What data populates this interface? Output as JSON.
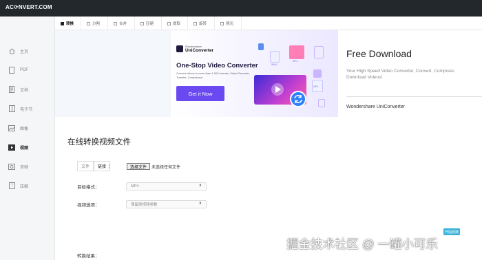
{
  "brand": "AC⟳NVERT.COM",
  "sidebar": {
    "items": [
      {
        "label": "主页",
        "icon": "home-icon"
      },
      {
        "label": "PDF",
        "icon": "pdf-icon"
      },
      {
        "label": "文档",
        "icon": "document-icon"
      },
      {
        "label": "电子书",
        "icon": "ebook-icon"
      },
      {
        "label": "图像",
        "icon": "image-icon"
      },
      {
        "label": "视频",
        "icon": "video-icon",
        "active": true
      },
      {
        "label": "音频",
        "icon": "audio-icon"
      },
      {
        "label": "压缩",
        "icon": "archive-icon"
      }
    ]
  },
  "tabs": [
    {
      "label": "转换",
      "active": true
    },
    {
      "label": "分割"
    },
    {
      "label": "合并"
    },
    {
      "label": "压缩"
    },
    {
      "label": "提取"
    },
    {
      "label": "旋转"
    },
    {
      "label": "镜光"
    }
  ],
  "ad": {
    "brand_small": "Wondershare",
    "brand_large": "UniConverter",
    "title": "One-Stop Video Converter",
    "desc": "Convert videos to more than 1,000 formats, Video Recorder, Transfer, Compressor",
    "button": "Get it Now",
    "file_labels": [
      "WMV",
      "MP4",
      "WMV",
      "MP4"
    ]
  },
  "download": {
    "title": "Free Download",
    "desc_line1": "Your High Speed Video Converter, Convert, Compress",
    "desc_line2": "Download Videos!",
    "footer": "Wondershare UniConverter"
  },
  "form": {
    "section_title": "在线转换视频文件",
    "file_tab": "文件",
    "link_tab": "链接",
    "colon": "：",
    "choose_button": "选择文件",
    "choose_text": "未选择任何文件",
    "target_label": "目标格式：",
    "target_value": "MP4",
    "option_label": "视频选项：",
    "option_value": "保留原视频参数",
    "start_button": "开始转换",
    "result_label": "转换结果："
  },
  "watermark": "掘金技术社区 @ 一罐小可乐",
  "colors": {
    "topbar": "#23282d",
    "accent_purple": "#6a4af0",
    "start_button": "#3cb4d8"
  }
}
